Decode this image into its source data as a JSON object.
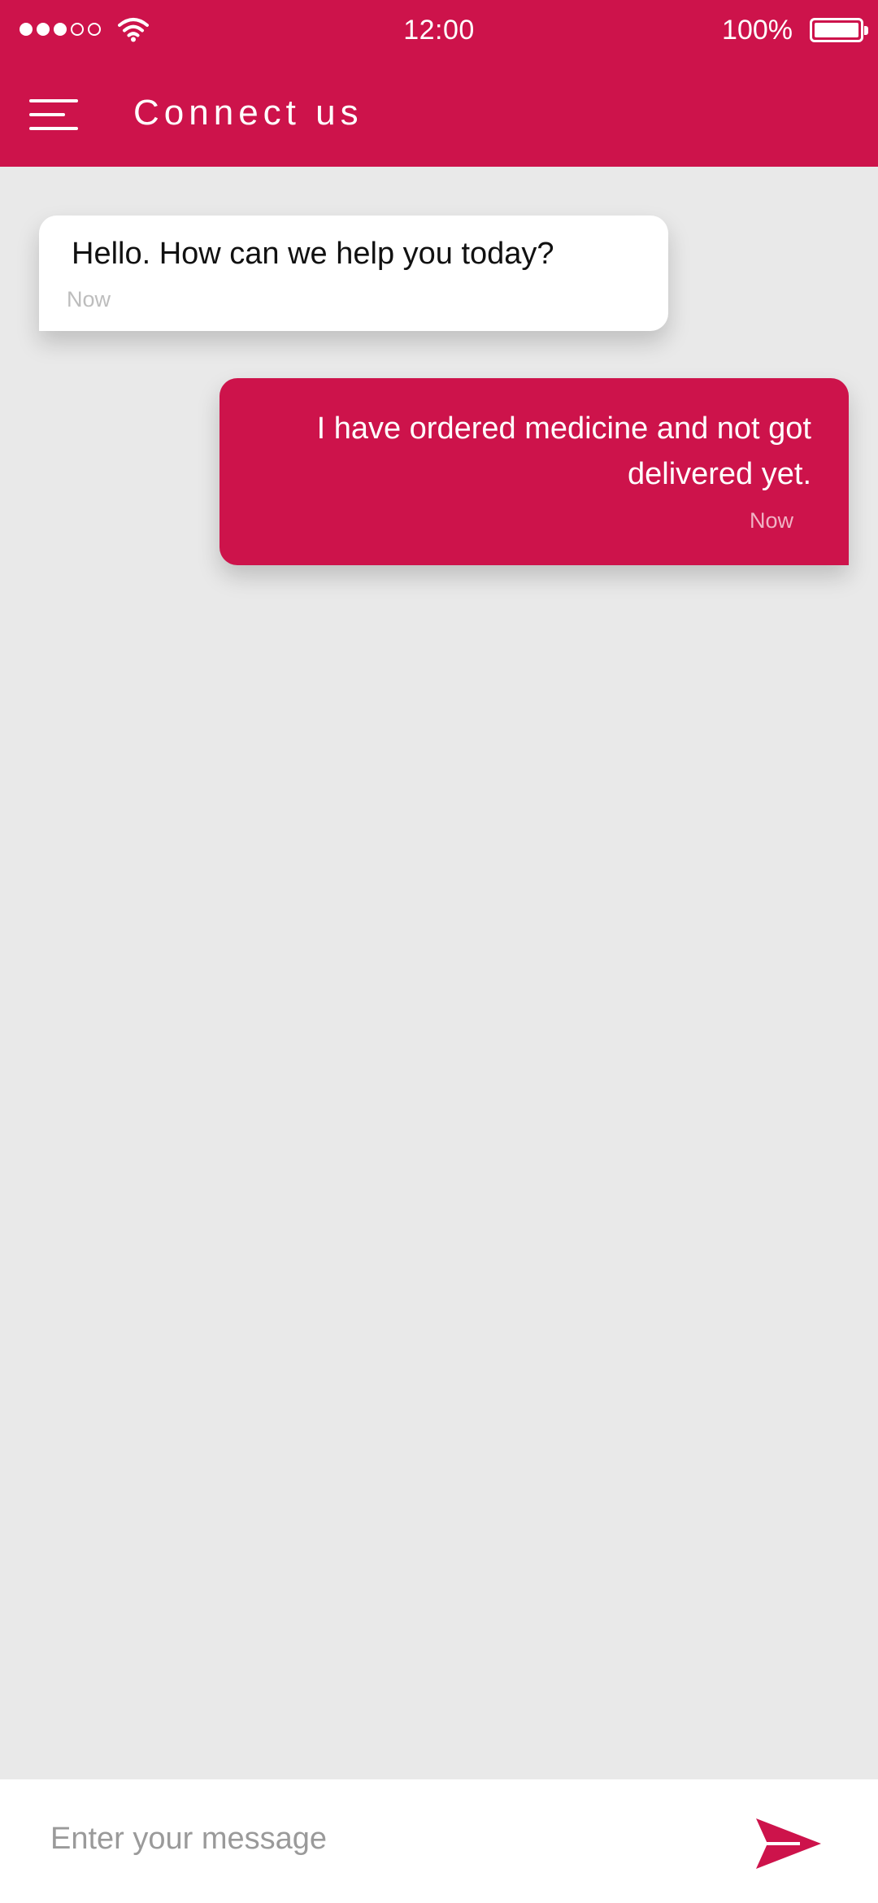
{
  "status_bar": {
    "time": "12:00",
    "battery": "100%",
    "signal_strength": {
      "bars_filled": 3,
      "bars_total": 5
    }
  },
  "header": {
    "title": "Connect us"
  },
  "messages": [
    {
      "direction": "incoming",
      "text": "Hello. How can we help you today?",
      "timestamp": "Now"
    },
    {
      "direction": "outgoing",
      "text": "I have ordered medicine and not got delivered yet.",
      "timestamp": "Now"
    }
  ],
  "composer": {
    "placeholder": "Enter your message",
    "value": ""
  },
  "icons": {
    "menu": "menu-icon",
    "send": "send-icon",
    "wifi": "wifi-icon",
    "battery": "battery-icon"
  },
  "colors": {
    "brand": "#cd134b",
    "background": "#e9e9e9",
    "incoming_bubble": "#ffffff",
    "outgoing_bubble": "#cd134b"
  }
}
